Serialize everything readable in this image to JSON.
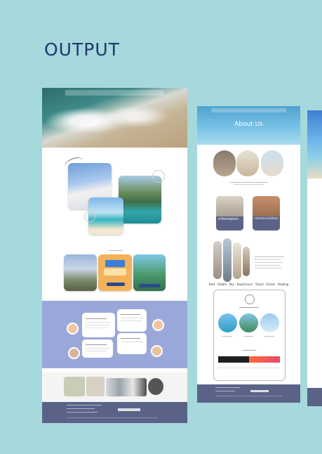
{
  "heading": "OUTPUT",
  "page2": {
    "hero_title": "About Us",
    "card_left_label": "information",
    "card_right_label": "communication",
    "tagline": "Rest · Stable · Sky · Experience · Travel · Ocean · Healing"
  },
  "colors": {
    "background": "#a6d9dc",
    "title": "#1e3a6e",
    "lavender_section": "#9aa8d9",
    "footer": "#5a6387"
  }
}
